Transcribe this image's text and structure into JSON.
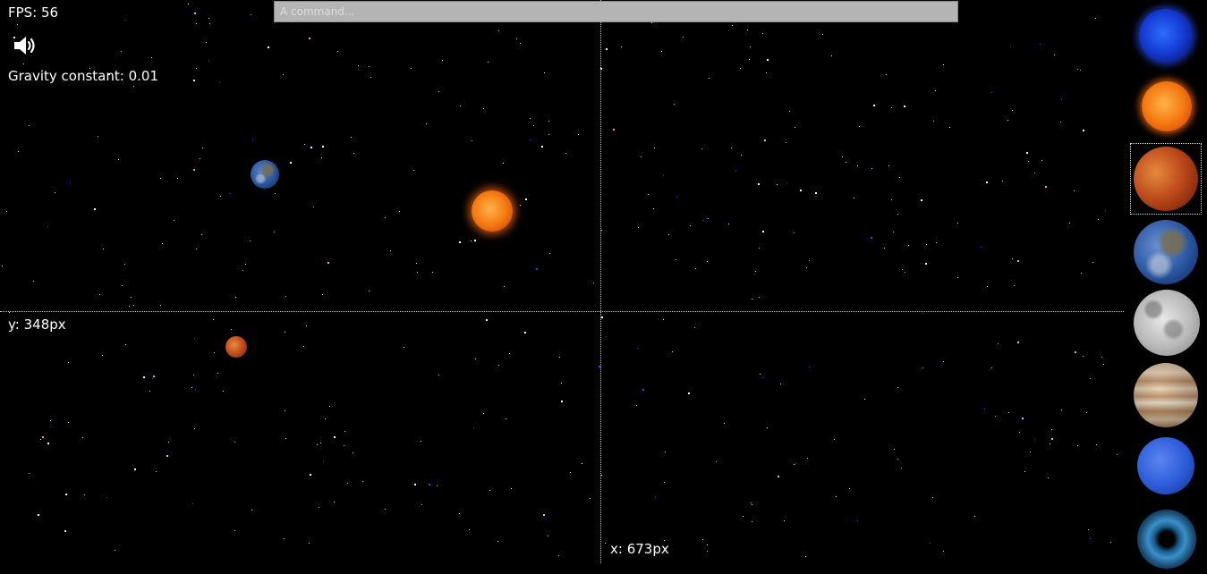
{
  "hud": {
    "fps": "FPS: 56",
    "gravity": "Gravity constant: 0.01",
    "y_coord": "y: 348px",
    "x_coord": "x: 673px",
    "sound_icon": "speaker-volume-icon"
  },
  "command": {
    "placeholder": "A command...",
    "value": ""
  },
  "scene_bodies": [
    {
      "name": "sun",
      "icon": "sun-icon"
    },
    {
      "name": "earth",
      "icon": "earth-icon"
    },
    {
      "name": "mars",
      "icon": "mars-icon"
    }
  ],
  "palette": {
    "items": [
      {
        "name": "blue-star",
        "icon": "blue-star-icon",
        "selected": false
      },
      {
        "name": "sun",
        "icon": "sun-icon",
        "selected": false
      },
      {
        "name": "mars",
        "icon": "mars-icon",
        "selected": true
      },
      {
        "name": "earth",
        "icon": "earth-icon",
        "selected": false
      },
      {
        "name": "moon",
        "icon": "moon-icon",
        "selected": false
      },
      {
        "name": "jupiter",
        "icon": "jupiter-icon",
        "selected": false
      },
      {
        "name": "neptune",
        "icon": "neptune-icon",
        "selected": false
      },
      {
        "name": "black-hole",
        "icon": "black-hole-icon",
        "selected": false
      }
    ]
  },
  "colors": {
    "background": "#000000",
    "text": "#ffffff",
    "command_bg": "#b4b4b4",
    "crosshair": "#cfcfcf"
  }
}
